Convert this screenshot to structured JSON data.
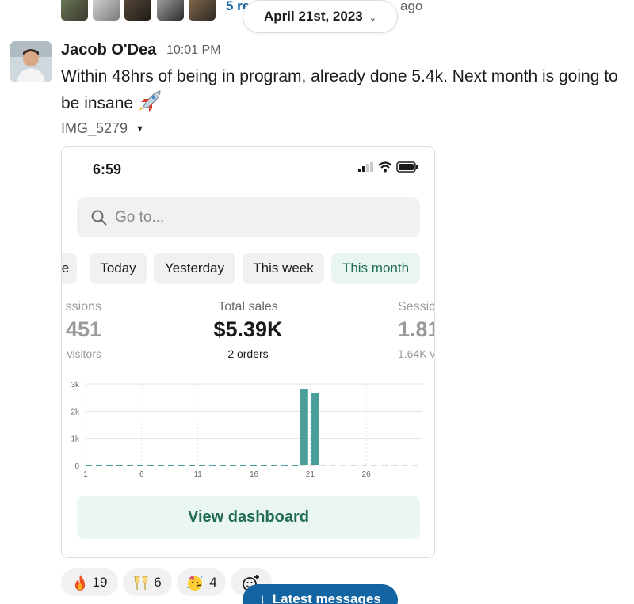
{
  "thread": {
    "replies_label": "5 re",
    "ago_label": "ago"
  },
  "date_divider": {
    "label": "April 21st, 2023"
  },
  "message": {
    "author": "Jacob O'Dea",
    "time": "10:01 PM",
    "text": "Within 48hrs of being in program, already done 5.4k. Next month is going to be insane",
    "emoji_icon": "rocket-icon"
  },
  "file": {
    "name": "IMG_5279"
  },
  "screenshot": {
    "phone_time": "6:59",
    "search_placeholder": "Go to...",
    "chips": [
      "e",
      "Today",
      "Yesterday",
      "This week",
      "This month"
    ],
    "active_chip": "This month",
    "metrics": [
      {
        "label": "ssions",
        "value": "451",
        "sub": "visitors"
      },
      {
        "label": "Total sales",
        "value": "$5.39K",
        "sub": "2 orders"
      },
      {
        "label": "Sessic",
        "value": "1.81",
        "sub": "1.64K v"
      }
    ],
    "dashboard_button": "View dashboard",
    "accent": "#4a9e9a"
  },
  "chart_data": {
    "type": "bar",
    "y_ticks": [
      "3k",
      "2k",
      "1k",
      "0"
    ],
    "x_ticks": [
      "1",
      "6",
      "11",
      "16",
      "21",
      "26"
    ],
    "ylim": [
      0,
      3000
    ],
    "xlim": [
      1,
      31
    ],
    "bars": [
      {
        "x": 20,
        "value": 2800
      },
      {
        "x": 21,
        "value": 2650
      }
    ],
    "baseline_dashed_until": 20,
    "grid": true
  },
  "reactions": [
    {
      "icon": "fire-icon",
      "count": "19"
    },
    {
      "icon": "clinking-glasses-icon",
      "count": "6"
    },
    {
      "icon": "partying-face-icon",
      "count": "4"
    }
  ],
  "latest_button": {
    "label": "Latest messages",
    "icon": "arrow-down-icon"
  }
}
